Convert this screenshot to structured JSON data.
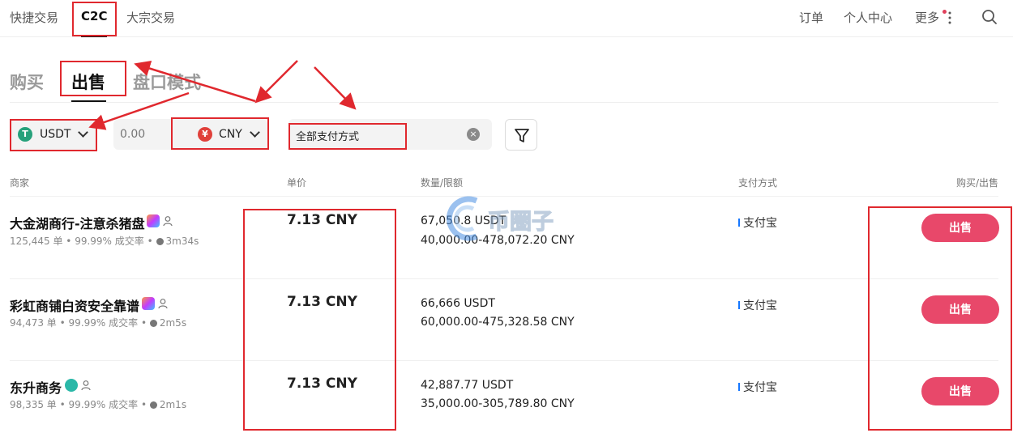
{
  "topnav": {
    "tabs": [
      "快捷交易",
      "C2C",
      "大宗交易"
    ],
    "right": [
      "订单",
      "个人中心",
      "更多"
    ]
  },
  "subtabs": [
    "购买",
    "出售",
    "盘口模式"
  ],
  "filters": {
    "coin": "USDT",
    "amount_placeholder": "0.00",
    "fiat": "CNY",
    "payment": "全部支付方式"
  },
  "table": {
    "headers": [
      "商家",
      "单价",
      "数量/限额",
      "支付方式",
      "购买/出售"
    ],
    "rows": [
      {
        "merchant": "大金湖商行-注意杀猪盘",
        "orders": "125,445 单",
        "rate": "99.99% 成交率",
        "time": "3m34s",
        "price": "7.13 CNY",
        "quantity": "67,050.8 USDT",
        "limit": "40,000.00-478,072.20 CNY",
        "payment": "支付宝",
        "action": "出售"
      },
      {
        "merchant": "彩虹商铺白资安全靠谱",
        "orders": "94,473 单",
        "rate": "99.99% 成交率",
        "time": "2m5s",
        "price": "7.13 CNY",
        "quantity": "66,666 USDT",
        "limit": "60,000.00-475,328.58 CNY",
        "payment": "支付宝",
        "action": "出售"
      },
      {
        "merchant": "东升商务",
        "orders": "98,335 单",
        "rate": "99.99% 成交率",
        "time": "2m1s",
        "price": "7.13 CNY",
        "quantity": "42,887.77 USDT",
        "limit": "35,000.00-305,789.80 CNY",
        "payment": "支付宝",
        "action": "出售"
      }
    ]
  },
  "watermark": "币圈子",
  "colors": {
    "accent": "#e8486a",
    "annotation": "#e0282e",
    "usdt": "#26a17b",
    "cny": "#e0403a"
  }
}
